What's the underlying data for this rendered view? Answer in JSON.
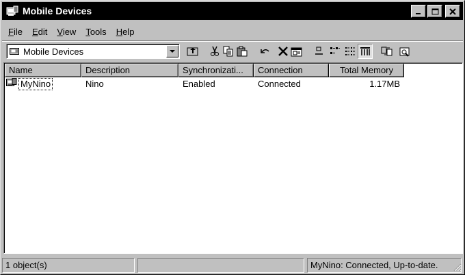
{
  "window": {
    "title": "Mobile Devices",
    "icon": "mobile-devices-icon"
  },
  "title_buttons": {
    "minimize": "_",
    "maximize": "□",
    "close": "×"
  },
  "menu": {
    "items": [
      {
        "label": "File",
        "mnemonic": "F"
      },
      {
        "label": "Edit",
        "mnemonic": "E"
      },
      {
        "label": "View",
        "mnemonic": "V"
      },
      {
        "label": "Tools",
        "mnemonic": "T"
      },
      {
        "label": "Help",
        "mnemonic": "H"
      }
    ]
  },
  "address": {
    "value": "Mobile Devices",
    "icon": "device-folder-icon"
  },
  "toolbar": {
    "buttons": [
      "up-folder",
      "cut",
      "copy",
      "paste",
      "undo",
      "delete",
      "properties",
      "large-icons",
      "small-icons",
      "list",
      "details",
      "synchronize",
      "explore"
    ]
  },
  "list": {
    "columns": [
      "Name",
      "Description",
      "Synchronizati...",
      "Connection",
      "Total Memory"
    ],
    "rows": [
      {
        "name": "MyNino",
        "description": "Nino",
        "sync": "Enabled",
        "connection": "Connected",
        "memory": "1.17MB"
      }
    ]
  },
  "status": {
    "count": "1 object(s)",
    "middle": "",
    "device_status": "MyNino: Connected, Up-to-date."
  },
  "colors": {
    "face": "#c0c0c0",
    "titlebar": "#000000",
    "window_bg": "#ffffff"
  }
}
